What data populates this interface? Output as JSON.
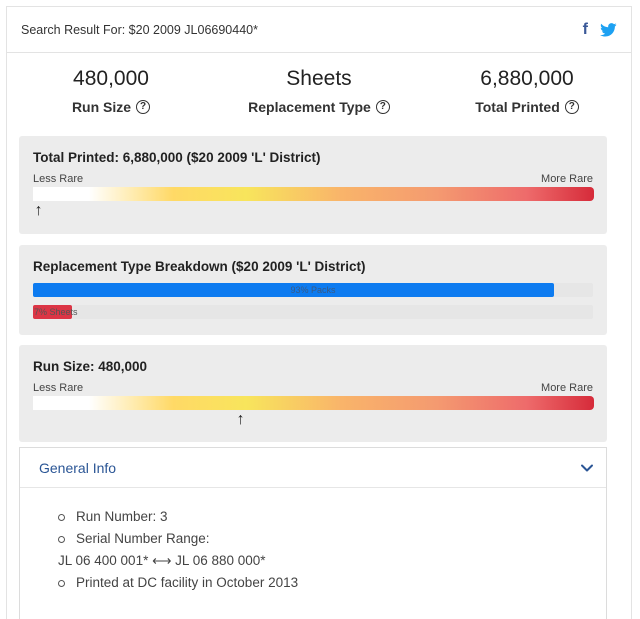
{
  "header": {
    "title": "Search Result For: $20 2009 JL06690440*",
    "facebook_icon": "facebook-icon",
    "twitter_icon": "twitter-icon"
  },
  "stats": [
    {
      "value": "480,000",
      "label": "Run Size"
    },
    {
      "value": "Sheets",
      "label": "Replacement Type"
    },
    {
      "value": "6,880,000",
      "label": "Total Printed"
    }
  ],
  "total_printed_panel": {
    "title": "Total Printed: 6,880,000 ($20 2009 'L' District)",
    "less_rare": "Less Rare",
    "more_rare": "More Rare",
    "marker_position": 0.01
  },
  "breakdown_panel": {
    "title": "Replacement Type Breakdown ($20 2009 'L' District)",
    "packs_label": "93% Packs",
    "packs_fraction": 0.93,
    "packs_color": "#0d7bf0",
    "sheets_label": "7% Sheets",
    "sheets_fraction": 0.07,
    "sheets_color": "#dc3545"
  },
  "run_size_panel": {
    "title": "Run Size: 480,000",
    "less_rare": "Less Rare",
    "more_rare": "More Rare",
    "marker_position": 0.37
  },
  "general_info": {
    "heading": "General Info",
    "items": [
      "Run Number: 3",
      "Serial Number Range:",
      "JL 06 400 001* ⟷ JL 06 880 000*",
      "Printed at DC facility in October 2013"
    ]
  },
  "colors": {
    "link_blue": "#2a5595",
    "panel_gray": "#ececec"
  }
}
